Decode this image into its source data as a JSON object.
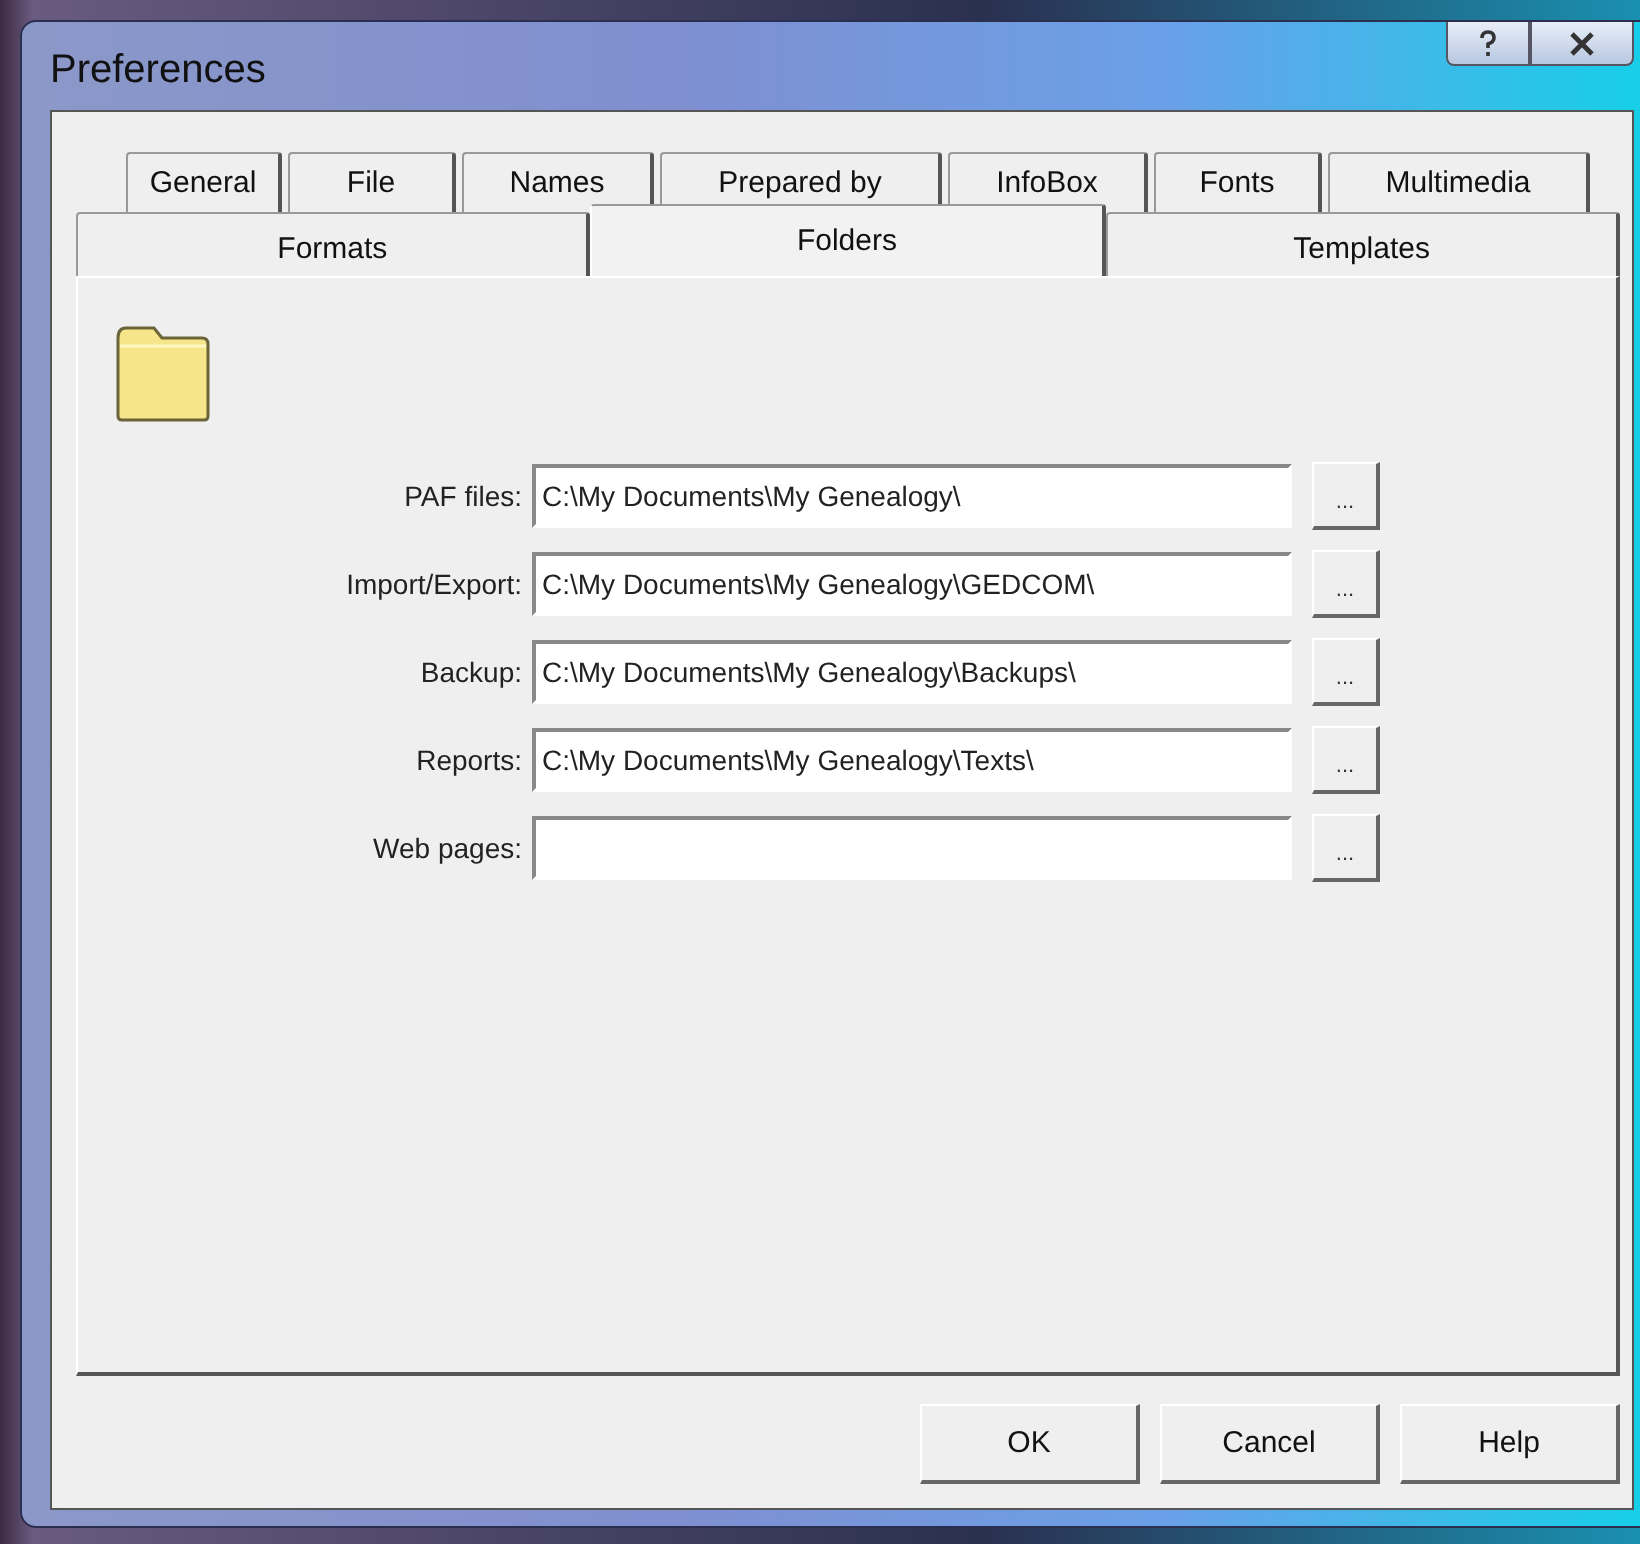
{
  "window": {
    "title": "Preferences"
  },
  "tab_rows": [
    [
      {
        "label": "General",
        "selected": false
      },
      {
        "label": "File",
        "selected": false
      },
      {
        "label": "Names",
        "selected": false
      },
      {
        "label": "Prepared by",
        "selected": false
      },
      {
        "label": "InfoBox",
        "selected": false
      },
      {
        "label": "Fonts",
        "selected": false
      },
      {
        "label": "Multimedia",
        "selected": false
      }
    ],
    [
      {
        "label": "Formats",
        "selected": false
      },
      {
        "label": "Folders",
        "selected": true
      },
      {
        "label": "Templates",
        "selected": false
      }
    ]
  ],
  "folders": [
    {
      "label": "PAF files:",
      "value": "C:\\My Documents\\My Genealogy\\",
      "browse": "..."
    },
    {
      "label": "Import/Export:",
      "value": "C:\\My Documents\\My Genealogy\\GEDCOM\\",
      "browse": "..."
    },
    {
      "label": "Backup:",
      "value": "C:\\My Documents\\My Genealogy\\Backups\\",
      "browse": "..."
    },
    {
      "label": "Reports:",
      "value": "C:\\My Documents\\My Genealogy\\Texts\\",
      "browse": "..."
    },
    {
      "label": "Web pages:",
      "browse": "..."
    }
  ],
  "buttons": [
    "OK",
    "Cancel",
    "Help"
  ]
}
